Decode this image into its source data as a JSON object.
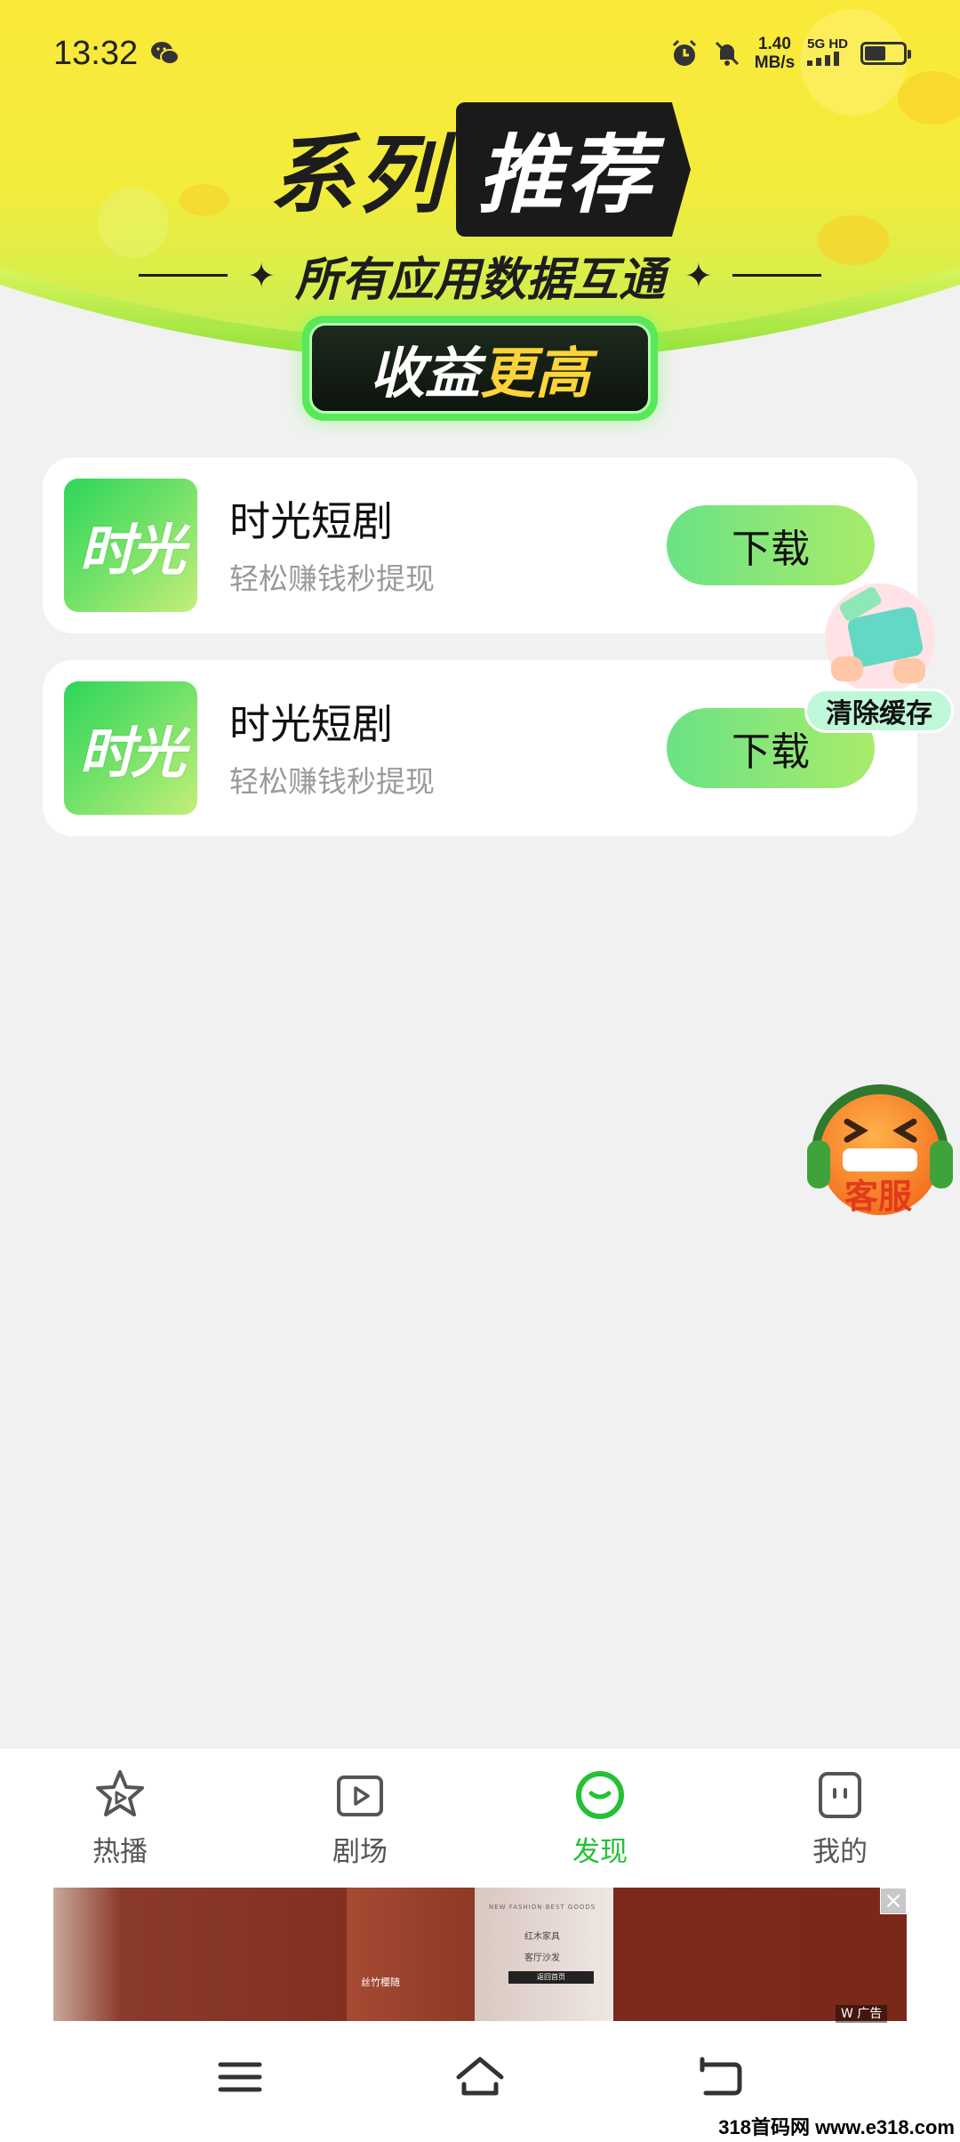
{
  "status_bar": {
    "time": "13:32",
    "net_speed_value": "1.40",
    "net_speed_unit": "MB/s",
    "network_type": "5G HD"
  },
  "hero": {
    "title_part1": "系列",
    "title_part2": "推荐",
    "subtitle": "所有应用数据互通",
    "badge_part1": "收益",
    "badge_part2": "更高"
  },
  "apps": [
    {
      "icon_text": "时光",
      "name": "时光短剧",
      "desc": "轻松赚钱秒提现",
      "button_label": "下载"
    },
    {
      "icon_text": "时光",
      "name": "时光短剧",
      "desc": "轻松赚钱秒提现",
      "button_label": "下载"
    }
  ],
  "floating": {
    "clear_cache_label": "清除缓存",
    "customer_service_label": "客服"
  },
  "bottom_nav": {
    "items": [
      {
        "label": "热播",
        "icon": "star-play-icon",
        "active": false
      },
      {
        "label": "剧场",
        "icon": "play-box-icon",
        "active": false
      },
      {
        "label": "发现",
        "icon": "discover-icon",
        "active": true
      },
      {
        "label": "我的",
        "icon": "profile-icon",
        "active": false
      }
    ]
  },
  "ad": {
    "image_title": "丝竹樱随",
    "image_text": "红木家具",
    "image_text2": "客厅沙发",
    "image_btn": "返回首页",
    "image_header": "NEW FASHION·BEST GOODS",
    "tag": "W 广告"
  },
  "watermark": "318首码网 www.e318.com",
  "colors": {
    "accent_green": "#24c136",
    "button_gradient_start": "#6be285",
    "button_gradient_end": "#a8ec6a",
    "hero_yellow": "#fde83a"
  }
}
